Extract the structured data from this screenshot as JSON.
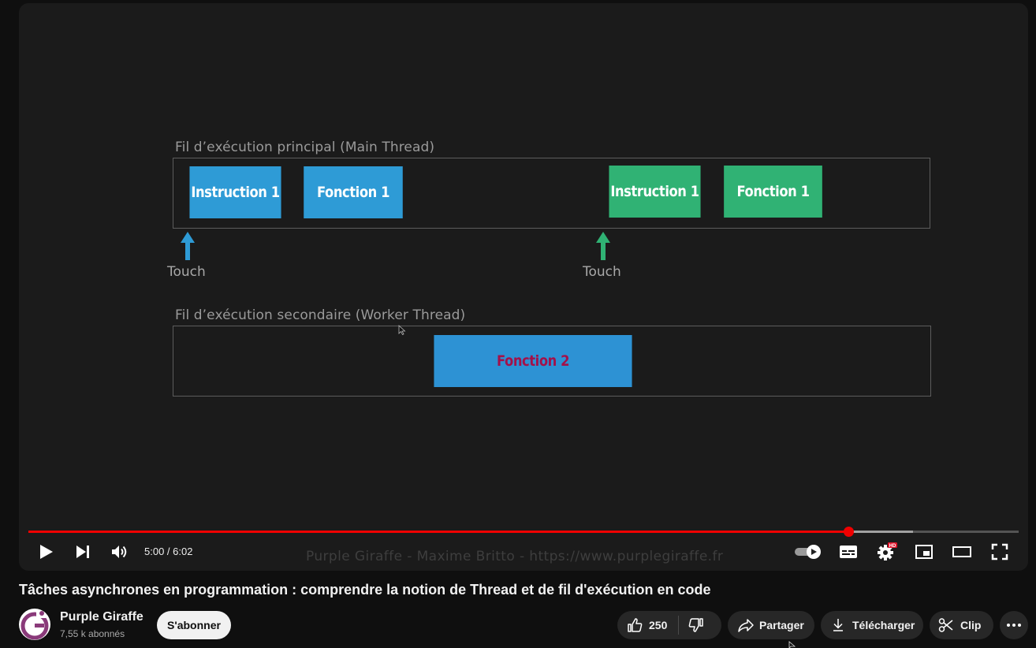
{
  "slide": {
    "main_thread_caption": "Fil d’exécution principal (Main Thread)",
    "worker_thread_caption": "Fil d’exécution secondaire (Worker Thread)",
    "blocks": {
      "blue_instruction": "Instruction 1",
      "blue_function": "Fonction 1",
      "green_instruction": "Instruction 1",
      "green_function": "Fonction 1",
      "worker_function": "Fonction 2"
    },
    "touch_labels": [
      "Touch",
      "Touch"
    ],
    "watermark": "Purple Giraffe - Maxime Britto - https://www.purplegiraffe.fr",
    "colors": {
      "blue": "#2e9bd6",
      "green": "#30b274",
      "worker_text": "#a3114a"
    }
  },
  "player": {
    "time": "5:00 / 6:02",
    "progress_fraction": 0.828,
    "buffer_fraction": 0.893,
    "accent": "#f00000",
    "quality_badge": "HD",
    "icons": [
      "play-icon",
      "next-icon",
      "volume-icon",
      "autoplay-toggle-icon",
      "subtitles-icon",
      "settings-icon",
      "miniplayer-icon",
      "theater-icon",
      "fullscreen-icon"
    ]
  },
  "video": {
    "title": "Tâches asynchrones en programmation : comprendre la notion de Thread et de fil d'exécution en code"
  },
  "channel": {
    "name": "Purple Giraffe",
    "subscribers": "7,55 k abonnés",
    "subscribe_label": "S'abonner",
    "avatar_letter": "G",
    "avatar_color": "#8a3a7a"
  },
  "actions": {
    "likes": "250",
    "share_label": "Partager",
    "download_label": "Télécharger",
    "clip_label": "Clip"
  }
}
